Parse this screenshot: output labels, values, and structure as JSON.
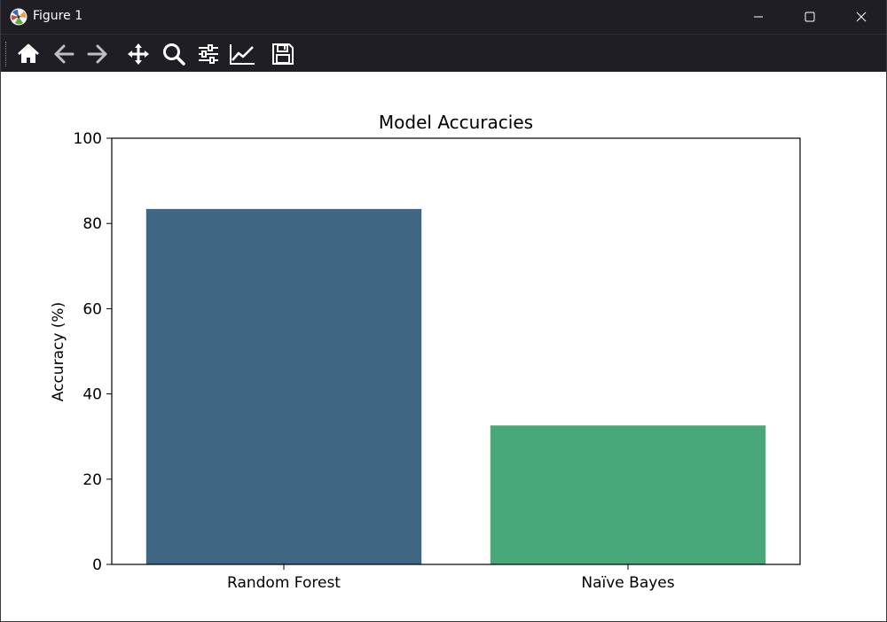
{
  "window": {
    "title": "Figure 1",
    "app_icon": "matplotlib-logo-icon",
    "controls": [
      "minimize-icon",
      "maximize-icon",
      "close-icon"
    ]
  },
  "toolbar": {
    "buttons": [
      {
        "name": "home",
        "icon": "home-icon"
      },
      {
        "name": "back",
        "icon": "arrow-left-icon"
      },
      {
        "name": "forward",
        "icon": "arrow-right-icon"
      },
      {
        "name": "pan",
        "icon": "move-icon"
      },
      {
        "name": "zoom",
        "icon": "magnifier-icon"
      },
      {
        "name": "configure-subplots",
        "icon": "sliders-icon"
      },
      {
        "name": "edit-axis",
        "icon": "line-chart-icon"
      },
      {
        "name": "save",
        "icon": "floppy-disk-icon"
      }
    ]
  },
  "colors": {
    "titlebar_bg": "#1f1e25",
    "bar_random_forest": "#3f6683",
    "bar_naive_bayes": "#49a879"
  },
  "chart_data": {
    "type": "bar",
    "title": "Model Accuracies",
    "xlabel": "",
    "ylabel": "Accuracy (%)",
    "categories": [
      "Random Forest",
      "Naïve Bayes"
    ],
    "values": [
      83.4,
      32.6
    ],
    "colors": [
      "#3f6683",
      "#49a879"
    ],
    "ylim": [
      0,
      100
    ],
    "yticks": [
      0,
      20,
      40,
      60,
      80,
      100
    ],
    "grid": false,
    "legend": "none"
  }
}
